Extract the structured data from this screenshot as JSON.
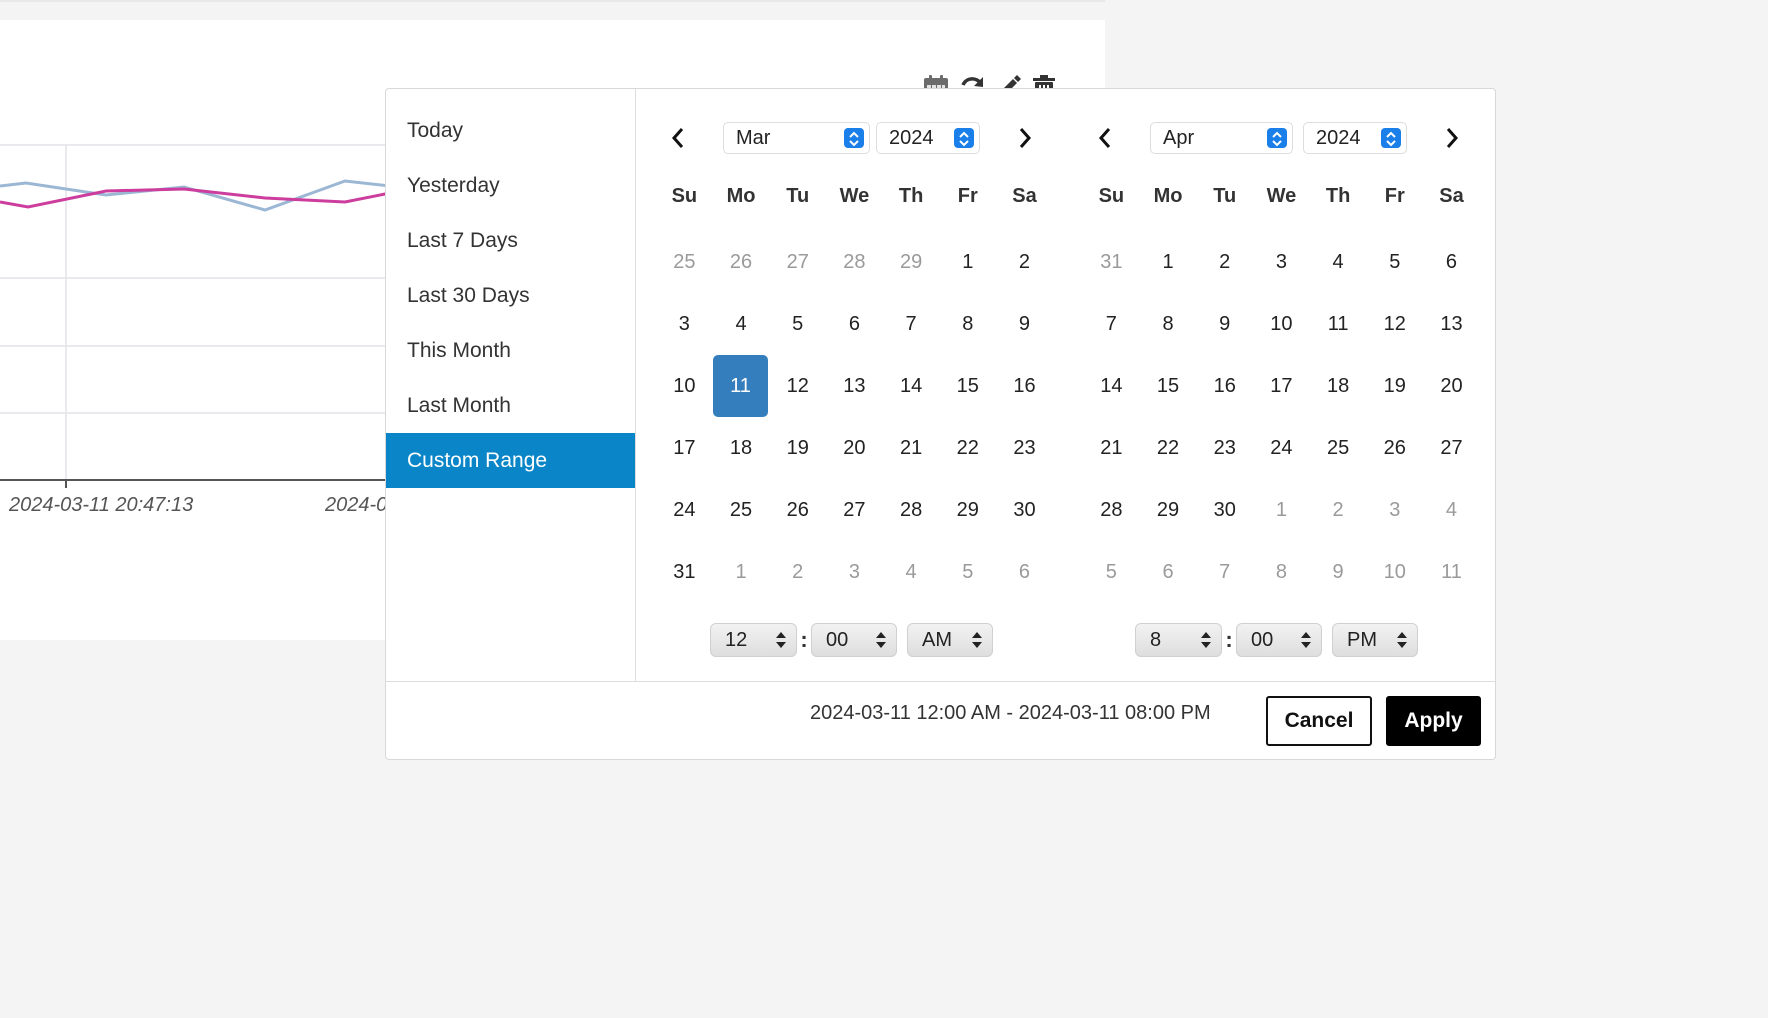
{
  "toolbar": {
    "icons": [
      "calendar-icon",
      "refresh-icon",
      "edit-icon",
      "trash-icon"
    ]
  },
  "chart": {
    "x_tick_labels": [
      "2024-03-11 20:47:13",
      "2024-0"
    ],
    "series_colors": [
      "#9bb7d4",
      "#cc3d9e"
    ]
  },
  "ranges": [
    {
      "label": "Today"
    },
    {
      "label": "Yesterday"
    },
    {
      "label": "Last 7 Days"
    },
    {
      "label": "Last 30 Days"
    },
    {
      "label": "This Month"
    },
    {
      "label": "Last Month"
    },
    {
      "label": "Custom Range",
      "active": true
    }
  ],
  "weekdays": [
    "Su",
    "Mo",
    "Tu",
    "We",
    "Th",
    "Fr",
    "Sa"
  ],
  "left_calendar": {
    "month": "Mar",
    "year": "2024",
    "days": [
      {
        "d": "25",
        "off": true
      },
      {
        "d": "26",
        "off": true
      },
      {
        "d": "27",
        "off": true
      },
      {
        "d": "28",
        "off": true
      },
      {
        "d": "29",
        "off": true
      },
      {
        "d": "1"
      },
      {
        "d": "2"
      },
      {
        "d": "3"
      },
      {
        "d": "4"
      },
      {
        "d": "5"
      },
      {
        "d": "6"
      },
      {
        "d": "7"
      },
      {
        "d": "8"
      },
      {
        "d": "9"
      },
      {
        "d": "10"
      },
      {
        "d": "11",
        "selected": true
      },
      {
        "d": "12"
      },
      {
        "d": "13"
      },
      {
        "d": "14"
      },
      {
        "d": "15"
      },
      {
        "d": "16"
      },
      {
        "d": "17"
      },
      {
        "d": "18"
      },
      {
        "d": "19"
      },
      {
        "d": "20"
      },
      {
        "d": "21"
      },
      {
        "d": "22"
      },
      {
        "d": "23"
      },
      {
        "d": "24"
      },
      {
        "d": "25"
      },
      {
        "d": "26"
      },
      {
        "d": "27"
      },
      {
        "d": "28"
      },
      {
        "d": "29"
      },
      {
        "d": "30"
      },
      {
        "d": "31"
      },
      {
        "d": "1",
        "off": true
      },
      {
        "d": "2",
        "off": true
      },
      {
        "d": "3",
        "off": true
      },
      {
        "d": "4",
        "off": true
      },
      {
        "d": "5",
        "off": true
      },
      {
        "d": "6",
        "off": true
      }
    ],
    "time": {
      "hour": "12",
      "minute": "00",
      "ampm": "AM"
    }
  },
  "right_calendar": {
    "month": "Apr",
    "year": "2024",
    "days": [
      {
        "d": "31",
        "off": true
      },
      {
        "d": "1"
      },
      {
        "d": "2"
      },
      {
        "d": "3"
      },
      {
        "d": "4"
      },
      {
        "d": "5"
      },
      {
        "d": "6"
      },
      {
        "d": "7"
      },
      {
        "d": "8"
      },
      {
        "d": "9"
      },
      {
        "d": "10"
      },
      {
        "d": "11"
      },
      {
        "d": "12"
      },
      {
        "d": "13"
      },
      {
        "d": "14"
      },
      {
        "d": "15"
      },
      {
        "d": "16"
      },
      {
        "d": "17"
      },
      {
        "d": "18"
      },
      {
        "d": "19"
      },
      {
        "d": "20"
      },
      {
        "d": "21"
      },
      {
        "d": "22"
      },
      {
        "d": "23"
      },
      {
        "d": "24"
      },
      {
        "d": "25"
      },
      {
        "d": "26"
      },
      {
        "d": "27"
      },
      {
        "d": "28"
      },
      {
        "d": "29"
      },
      {
        "d": "30"
      },
      {
        "d": "1",
        "off": true
      },
      {
        "d": "2",
        "off": true
      },
      {
        "d": "3",
        "off": true
      },
      {
        "d": "4",
        "off": true
      },
      {
        "d": "5",
        "off": true
      },
      {
        "d": "6",
        "off": true
      },
      {
        "d": "7",
        "off": true
      },
      {
        "d": "8",
        "off": true
      },
      {
        "d": "9",
        "off": true
      },
      {
        "d": "10",
        "off": true
      },
      {
        "d": "11",
        "off": true
      }
    ],
    "time": {
      "hour": "8",
      "minute": "00",
      "ampm": "PM"
    }
  },
  "footer": {
    "range_text": "2024-03-11 12:00 AM - 2024-03-11 08:00 PM",
    "cancel_label": "Cancel",
    "apply_label": "Apply"
  },
  "colors": {
    "active_range": "#0a86c8",
    "selected_day": "#357ebd",
    "select_stepper": "#1a7fe8"
  }
}
